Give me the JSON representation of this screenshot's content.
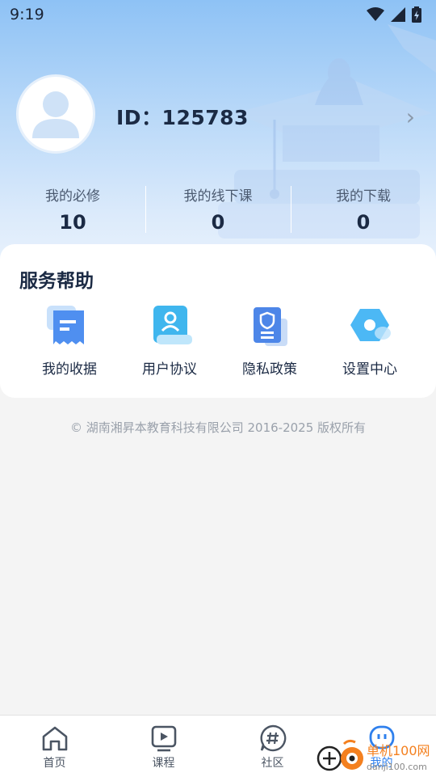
{
  "status_bar": {
    "time": "9:19"
  },
  "profile": {
    "id_text": "ID：125783",
    "chevron": "›"
  },
  "stats": [
    {
      "label": "我的必修",
      "value": "10"
    },
    {
      "label": "我的线下课",
      "value": "0"
    },
    {
      "label": "我的下载",
      "value": "0"
    }
  ],
  "services": {
    "title": "服务帮助",
    "items": [
      {
        "label": "我的收据",
        "icon": "receipt-icon"
      },
      {
        "label": "用户协议",
        "icon": "user-agreement-icon"
      },
      {
        "label": "隐私政策",
        "icon": "privacy-shield-icon"
      },
      {
        "label": "设置中心",
        "icon": "settings-hexagon-icon"
      }
    ]
  },
  "footer": {
    "copyright": "© 湖南湘昇本教育科技有限公司 2016-2025 版权所有"
  },
  "tabbar": {
    "items": [
      {
        "label": "首页",
        "icon": "home-icon"
      },
      {
        "label": "课程",
        "icon": "course-play-icon"
      },
      {
        "label": "社区",
        "icon": "community-hash-icon"
      },
      {
        "label": "我的",
        "icon": "profile-face-icon"
      }
    ],
    "active": "我的"
  },
  "watermark": {
    "text": "单机100网",
    "sub": "danji100.com"
  },
  "colors": {
    "accent": "#2f80ed",
    "hero_top": "#8ec2f5",
    "text_dark": "#1b2a44"
  }
}
